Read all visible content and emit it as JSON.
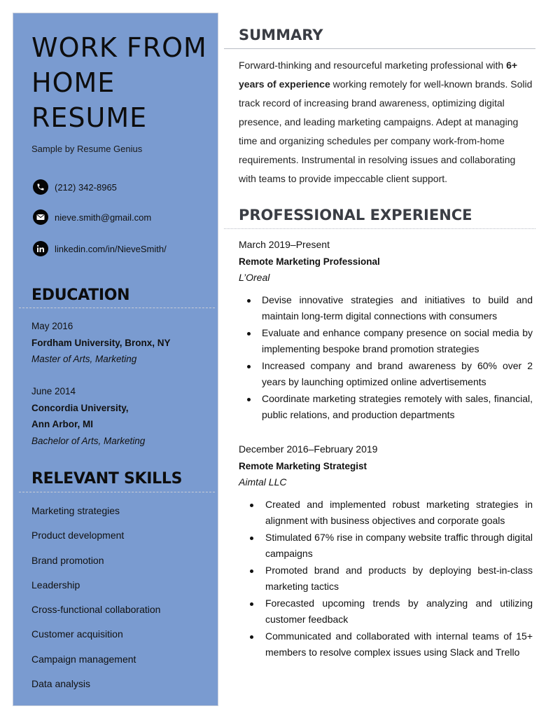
{
  "header": {
    "title_lines": [
      "WORK FROM",
      "HOME",
      "RESUME"
    ],
    "subtitle": "Sample by Resume Genius"
  },
  "contact": [
    {
      "icon": "phone-icon",
      "text": "(212) 342-8965"
    },
    {
      "icon": "email-icon",
      "text": "nieve.smith@gmail.com"
    },
    {
      "icon": "linkedin-icon",
      "text": "linkedin.com/in/NieveSmith/"
    }
  ],
  "education": {
    "heading": "EDUCATION",
    "entries": [
      {
        "date": "May 2016",
        "school_lines": [
          "Fordham University, Bronx, NY"
        ],
        "degree": "Master of Arts, Marketing"
      },
      {
        "date": "June 2014",
        "school_lines": [
          "Concordia University,",
          "Ann Arbor, MI"
        ],
        "degree": "Bachelor of Arts, Marketing"
      }
    ]
  },
  "skills": {
    "heading": "RELEVANT SKILLS",
    "items": [
      "Marketing strategies",
      "Product development",
      "Brand promotion",
      "Leadership",
      "Cross-functional collaboration",
      "Customer acquisition",
      "Campaign management",
      "Data analysis"
    ]
  },
  "summary": {
    "heading": "SUMMARY",
    "text_before": "Forward-thinking and resourceful marketing professional with ",
    "text_bold": "6+ years of experience",
    "text_after": " working remotely for well-known brands. Solid track record of increasing brand awareness, optimizing digital presence, and leading marketing campaigns. Adept at managing time and organizing schedules per company work-from-home requirements. Instrumental in resolving issues and collaborating with teams to provide impeccable client support."
  },
  "experience": {
    "heading": "PROFESSIONAL EXPERIENCE",
    "jobs": [
      {
        "dates": "March 2019–Present",
        "role": "Remote Marketing Professional",
        "company": "L’Oreal",
        "bullets": [
          "Devise innovative strategies and initiatives to build and maintain long-term digital connections with consumers",
          "Evaluate and enhance company presence on social media by implementing bespoke brand promotion strategies",
          "Increased company and brand awareness by 60% over 2 years by launching optimized online advertisements",
          "Coordinate marketing strategies remotely with sales, financial, public relations, and production departments"
        ]
      },
      {
        "dates": "December 2016–February 2019",
        "role": "Remote Marketing Strategist",
        "company": "Aimtal LLC",
        "bullets": [
          "Created and implemented robust marketing strategies in alignment with business objectives and corporate goals",
          "Stimulated 67% rise in company website traffic through digital campaigns",
          "Promoted brand and products by deploying best-in-class marketing tactics",
          "Forecasted upcoming trends by analyzing and utilizing customer feedback",
          "Communicated and collaborated with internal teams of 15+ members to resolve complex issues using Slack and Trello"
        ]
      }
    ]
  },
  "colors": {
    "sidebar_bg": "#7a9bd0",
    "heading_gray": "#3a3d44",
    "text": "#111111"
  }
}
